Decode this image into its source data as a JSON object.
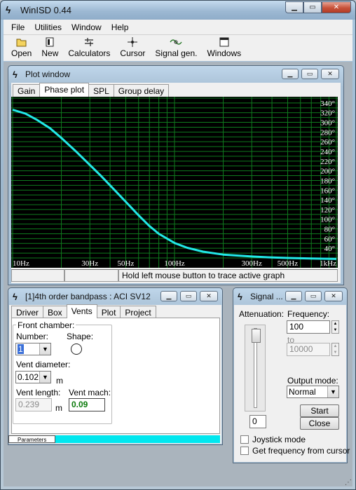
{
  "app": {
    "title": "WinISD 0.44"
  },
  "menu": [
    "File",
    "Utilities",
    "Window",
    "Help"
  ],
  "toolbar": [
    {
      "label": "Open",
      "icon": "folder-icon"
    },
    {
      "label": "New",
      "icon": "new-document-icon"
    },
    {
      "label": "Calculators",
      "icon": "calculator-icon"
    },
    {
      "label": "Cursor",
      "icon": "cursor-icon"
    },
    {
      "label": "Signal gen.",
      "icon": "signal-generator-icon"
    },
    {
      "label": "Windows",
      "icon": "windows-icon"
    }
  ],
  "plot_window": {
    "title": "Plot window",
    "tabs": [
      "Gain",
      "Phase plot",
      "SPL",
      "Group delay"
    ],
    "active_tab": "Phase plot",
    "status_hint": "Hold left mouse button to trace active graph"
  },
  "chart_data": {
    "type": "line",
    "title": "",
    "xlabel": "",
    "ylabel": "",
    "x_scale": "log",
    "xlim": [
      10,
      1000
    ],
    "ylim": [
      20,
      350
    ],
    "grid": true,
    "x_tick_labels": [
      {
        "value": 10,
        "label": "10Hz"
      },
      {
        "value": 30,
        "label": "30Hz"
      },
      {
        "value": 50,
        "label": "50Hz"
      },
      {
        "value": 100,
        "label": "100Hz"
      },
      {
        "value": 300,
        "label": "300Hz"
      },
      {
        "value": 500,
        "label": "500Hz"
      },
      {
        "value": 1000,
        "label": "1kHz"
      }
    ],
    "y_tick_labels": [
      "340°",
      "320°",
      "300°",
      "280°",
      "260°",
      "240°",
      "220°",
      "200°",
      "180°",
      "160°",
      "140°",
      "120°",
      "100°",
      "80°",
      "60°",
      "40°"
    ],
    "y_tick_values": [
      340,
      320,
      300,
      280,
      260,
      240,
      220,
      200,
      180,
      160,
      140,
      120,
      100,
      80,
      60,
      40
    ],
    "series": [
      {
        "color": "#22e8e8",
        "x": [
          10,
          12,
          14,
          17,
          20,
          25,
          30,
          35,
          40,
          50,
          60,
          70,
          80,
          100,
          120,
          150,
          200,
          300,
          400,
          500,
          700,
          1000
        ],
        "y": [
          326,
          318,
          306,
          288,
          268,
          238,
          212,
          190,
          170,
          136,
          108,
          86,
          70,
          51,
          41,
          33,
          27,
          23,
          21,
          20,
          19,
          18
        ]
      }
    ]
  },
  "bandpass_window": {
    "title": "[1]4th order bandpass : ACI SV12",
    "tabs": [
      "Driver",
      "Box",
      "Vents",
      "Plot",
      "Project"
    ],
    "active_tab": "Vents",
    "front_chamber_label": "Front chamber:",
    "number_label": "Number:",
    "number_value": "1",
    "shape_label": "Shape:",
    "vent_diameter_label": "Vent diameter:",
    "vent_diameter_value": "0.102",
    "vent_diameter_unit": "m",
    "vent_length_label": "Vent length:",
    "vent_length_value": "0.239",
    "vent_length_unit": "m",
    "vent_mach_label": "Vent mach:",
    "vent_mach_value": "0.09",
    "bottom_tab": "Parameters"
  },
  "signal_window": {
    "title": "Signal ...",
    "attenuation_label": "Attenuation:",
    "attenuation_value": "0",
    "frequency_label": "Frequency:",
    "frequency_value": "100",
    "to_label": "to",
    "to_value": "10000",
    "output_mode_label": "Output mode:",
    "output_mode_value": "Normal",
    "start_label": "Start",
    "close_label": "Close",
    "joystick_label": "Joystick mode",
    "get_freq_label": "Get frequency from cursor"
  },
  "colors": {
    "plot_background": "#000000",
    "grid": "#0f7a1e",
    "curve": "#22e8e8",
    "mach_value": "#0a7a0a"
  }
}
